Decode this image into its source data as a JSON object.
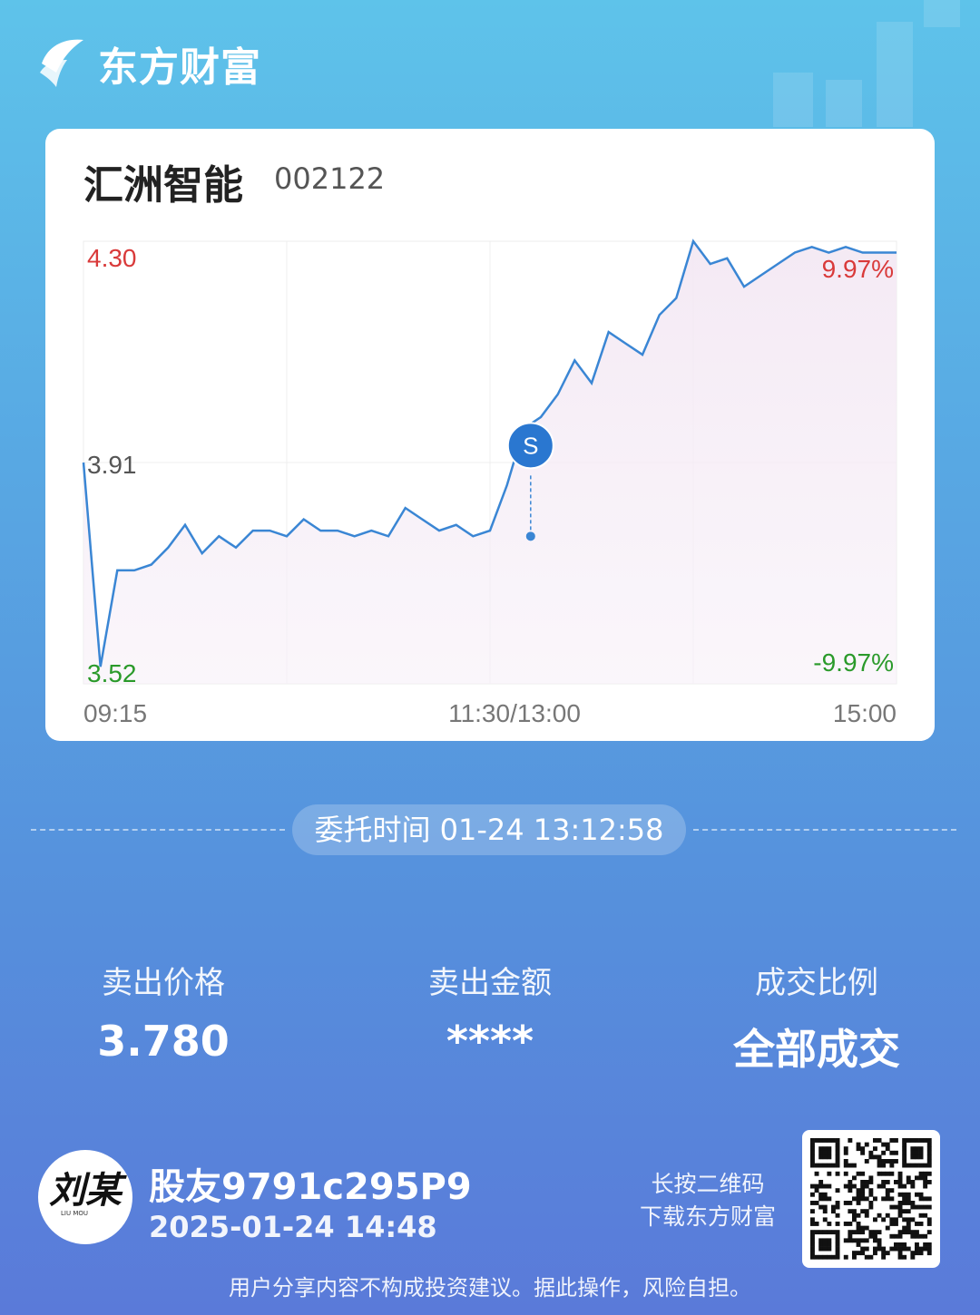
{
  "brand": {
    "name": "东方财富",
    "accent": "#5ec3ea"
  },
  "stock": {
    "name": "汇洲智能",
    "code": "002122"
  },
  "chart_data": {
    "type": "line",
    "x_ticks": [
      "09:15",
      "11:30/13:00",
      "15:00"
    ],
    "y_ticks": {
      "top": "4.30",
      "mid": "3.91",
      "bottom": "3.52"
    },
    "pct_labels": {
      "up": "9.97%",
      "down": "-9.97%"
    },
    "ylim": [
      3.52,
      4.3
    ],
    "series": [
      {
        "color": "#3a86d4",
        "x": [
          "09:30",
          "09:35",
          "09:40",
          "09:45",
          "09:50",
          "09:55",
          "10:00",
          "10:05",
          "10:10",
          "10:15",
          "10:20",
          "10:25",
          "10:30",
          "10:35",
          "10:40",
          "10:45",
          "10:50",
          "10:55",
          "11:00",
          "11:05",
          "11:10",
          "11:15",
          "11:20",
          "11:25",
          "11:30",
          "13:00",
          "13:05",
          "13:10",
          "13:15",
          "13:20",
          "13:25",
          "13:30",
          "13:35",
          "13:40",
          "13:45",
          "13:50",
          "13:55",
          "14:00",
          "14:05",
          "14:10",
          "14:15",
          "14:20",
          "14:25",
          "14:30",
          "14:35",
          "14:40",
          "14:45",
          "14:50",
          "14:55",
          "15:00"
        ],
        "y": [
          3.91,
          3.55,
          3.72,
          3.72,
          3.73,
          3.76,
          3.8,
          3.75,
          3.78,
          3.76,
          3.79,
          3.79,
          3.78,
          3.81,
          3.79,
          3.79,
          3.78,
          3.79,
          3.78,
          3.83,
          3.81,
          3.79,
          3.8,
          3.78,
          3.79,
          3.79,
          3.87,
          3.97,
          3.99,
          4.03,
          4.09,
          4.05,
          4.14,
          4.12,
          4.1,
          4.17,
          4.2,
          4.3,
          4.26,
          4.27,
          4.22,
          4.24,
          4.26,
          4.28,
          4.29,
          4.28,
          4.29,
          4.28,
          4.28,
          4.28
        ]
      }
    ],
    "marker": {
      "label": "S",
      "time": "13:12",
      "price": 3.78
    }
  },
  "order": {
    "time_label": "委托时间 01-24 13:12:58"
  },
  "stats": [
    {
      "label": "卖出价格",
      "value": "3.780"
    },
    {
      "label": "卖出金额",
      "value": "****"
    },
    {
      "label": "成交比例",
      "value": "全部成交"
    }
  ],
  "user": {
    "name": "股友9791c295P9",
    "time": "2025-01-24 14:48",
    "avatar_text": "刘某",
    "avatar_sub": "LIU MOU"
  },
  "qr": {
    "hint_line1": "长按二维码",
    "hint_line2": "下载东方财富"
  },
  "disclaimer": "用户分享内容不构成投资建议。据此操作，风险自担。"
}
